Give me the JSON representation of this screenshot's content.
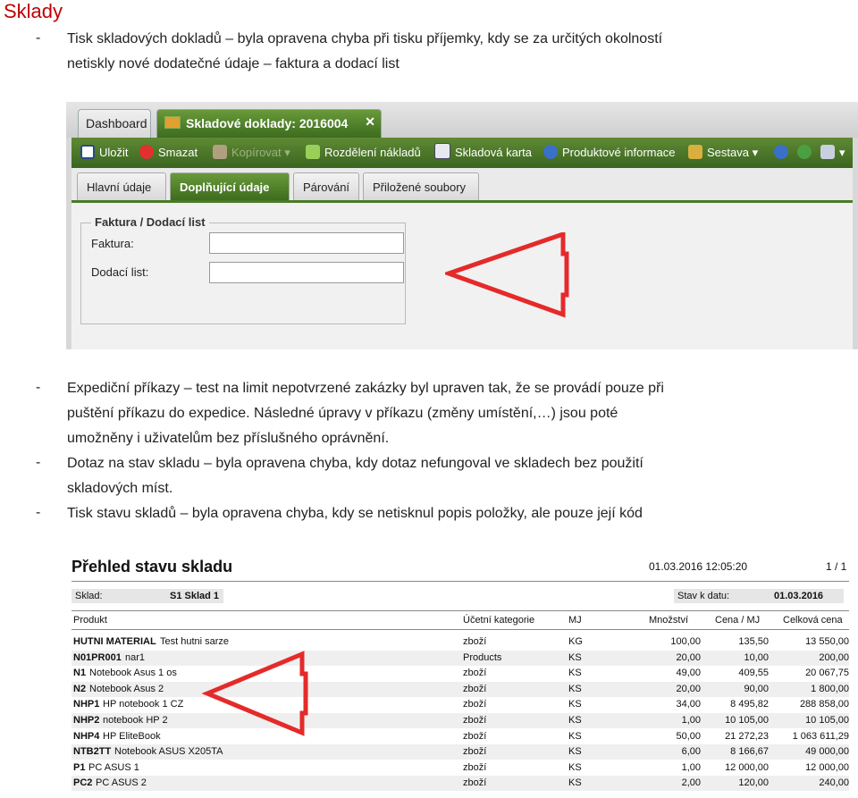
{
  "heading": "Sklady",
  "bullet_char": "-",
  "para1_line1": "Tisk skladových dokladů – byla opravena chyba při tisku příjemky, kdy se za určitých okolností",
  "para1_line2": "netiskly nové dodatečné údaje – faktura a dodací list",
  "para2_line1": "Expediční příkazy – test na limit nepotvrzené zakázky byl upraven tak, že se provádí pouze při",
  "para2_line2": "puštění příkazu do expedice. Následné úpravy v příkazu (změny umístění,…) jsou poté",
  "para2_line3": "umožněny i uživatelům bez příslušného oprávnění.",
  "para3_line1": "Dotaz na stav skladu – byla opravena chyba, kdy dotaz nefungoval ve skladech bez použití",
  "para3_line2": "skladových míst.",
  "para4_line1": "Tisk stavu skladů – byla opravena chyba, kdy se netisknul popis položky, ale pouze její kód",
  "app": {
    "tab_dashboard": "Dashboard",
    "tab_active": "Skladové doklady: 2016004",
    "tab_close": "✕",
    "toolbar": {
      "save": "Uložit",
      "delete": "Smazat",
      "copy": "Kopírovat",
      "cost_split": "Rozdělení nákladů",
      "stock_card": "Skladová karta",
      "product_info": "Produktové informace",
      "report": "Sestava"
    },
    "subtabs": [
      "Hlavní údaje",
      "Doplňující údaje",
      "Párování",
      "Přiložené soubory"
    ],
    "fieldset_legend": "Faktura / Dodací list",
    "label_invoice": "Faktura:",
    "label_delivery": "Dodací list:",
    "invoice_value": "",
    "delivery_value": ""
  },
  "report": {
    "title": "Přehled stavu skladu",
    "datetime": "01.03.2016 12:05:20",
    "page": "1 / 1",
    "warehouse_label": "Sklad:",
    "warehouse_value": "S1 Sklad 1",
    "stock_date_label": "Stav k datu:",
    "stock_date_value": "01.03.2016",
    "columns": [
      "Produkt",
      "Účetní kategorie",
      "MJ",
      "Množství",
      "Cena / MJ",
      "Celková cena"
    ],
    "rows": [
      {
        "code": "HUTNI MATERIAL",
        "name": "Test hutni sarze",
        "cat": "zboží",
        "mj": "KG",
        "qty": "100,00",
        "price": "135,50",
        "total": "13 550,00"
      },
      {
        "code": "N01PR001",
        "name": "nar1",
        "cat": "Products",
        "mj": "KS",
        "qty": "20,00",
        "price": "10,00",
        "total": "200,00"
      },
      {
        "code": "N1",
        "name": "Notebook Asus 1 os",
        "cat": "zboží",
        "mj": "KS",
        "qty": "49,00",
        "price": "409,55",
        "total": "20 067,75"
      },
      {
        "code": "N2",
        "name": "Notebook Asus 2",
        "cat": "zboží",
        "mj": "KS",
        "qty": "20,00",
        "price": "90,00",
        "total": "1 800,00"
      },
      {
        "code": "NHP1",
        "name": "HP notebook 1 CZ",
        "cat": "zboží",
        "mj": "KS",
        "qty": "34,00",
        "price": "8 495,82",
        "total": "288 858,00"
      },
      {
        "code": "NHP2",
        "name": "notebook HP 2",
        "cat": "zboží",
        "mj": "KS",
        "qty": "1,00",
        "price": "10 105,00",
        "total": "10 105,00"
      },
      {
        "code": "NHP4",
        "name": "HP EliteBook",
        "cat": "zboží",
        "mj": "KS",
        "qty": "50,00",
        "price": "21 272,23",
        "total": "1 063 611,29"
      },
      {
        "code": "NTB2TT",
        "name": "Notebook ASUS X205TA",
        "cat": "zboží",
        "mj": "KS",
        "qty": "6,00",
        "price": "8 166,67",
        "total": "49 000,00"
      },
      {
        "code": "P1",
        "name": "PC ASUS 1",
        "cat": "zboží",
        "mj": "KS",
        "qty": "1,00",
        "price": "12 000,00",
        "total": "12 000,00"
      },
      {
        "code": "PC2",
        "name": "PC ASUS 2",
        "cat": "zboží",
        "mj": "KS",
        "qty": "2,00",
        "price": "120,00",
        "total": "240,00"
      }
    ]
  }
}
